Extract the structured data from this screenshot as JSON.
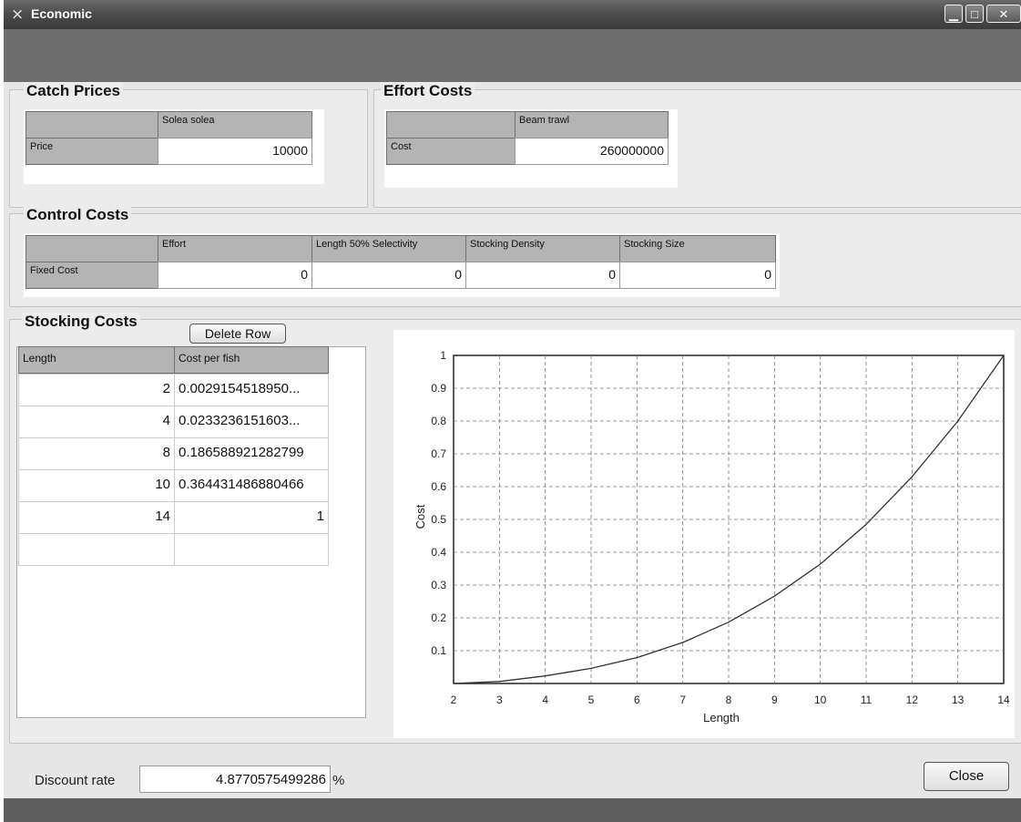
{
  "window": {
    "title": "Economic",
    "controls": {
      "minimize": "▁",
      "maximize": "□",
      "close": "✕"
    }
  },
  "catch_prices": {
    "title": "Catch Prices",
    "column": "Solea solea",
    "row_label": "Price",
    "value": "10000"
  },
  "effort_costs": {
    "title": "Effort Costs",
    "column": "Beam trawl",
    "row_label": "Cost",
    "value": "260000000"
  },
  "control_costs": {
    "title": "Control Costs",
    "columns": [
      "Effort",
      "Length 50% Selectivity",
      "Stocking Density",
      "Stocking Size"
    ],
    "row_label": "Fixed Cost",
    "values": [
      "0",
      "0",
      "0",
      "0"
    ]
  },
  "stocking_costs": {
    "title": "Stocking Costs",
    "delete_button": "Delete Row",
    "columns": [
      "Length",
      "Cost per fish"
    ],
    "rows": [
      {
        "length": "2",
        "cost": "0.0029154518950..."
      },
      {
        "length": "4",
        "cost": "0.0233236151603..."
      },
      {
        "length": "8",
        "cost": "0.186588921282799"
      },
      {
        "length": "10",
        "cost": "0.364431486880466"
      },
      {
        "length": "14",
        "cost": "1"
      }
    ]
  },
  "chart_data": {
    "type": "line",
    "xlabel": "Length",
    "ylabel": "Cost",
    "xlim": [
      2,
      14
    ],
    "ylim": [
      0,
      1
    ],
    "x_ticks": [
      "2",
      "3",
      "4",
      "5",
      "6",
      "7",
      "8",
      "9",
      "10",
      "11",
      "12",
      "13",
      "14"
    ],
    "y_ticks": [
      "0.1",
      "0.2",
      "0.3",
      "0.4",
      "0.5",
      "0.6",
      "0.7",
      "0.8",
      "0.9",
      "1"
    ],
    "grid": true,
    "series": [
      {
        "x": [
          2,
          3,
          4,
          5,
          6,
          7,
          8,
          9,
          10,
          11,
          12,
          13,
          14
        ],
        "y": [
          0,
          0.006,
          0.023,
          0.046,
          0.079,
          0.125,
          0.187,
          0.266,
          0.364,
          0.485,
          0.63,
          0.8,
          1
        ],
        "color": "#333333"
      }
    ]
  },
  "footer": {
    "discount_label": "Discount rate",
    "discount_value": "4.8770575499286",
    "discount_unit": "%",
    "close_button": "Close"
  }
}
